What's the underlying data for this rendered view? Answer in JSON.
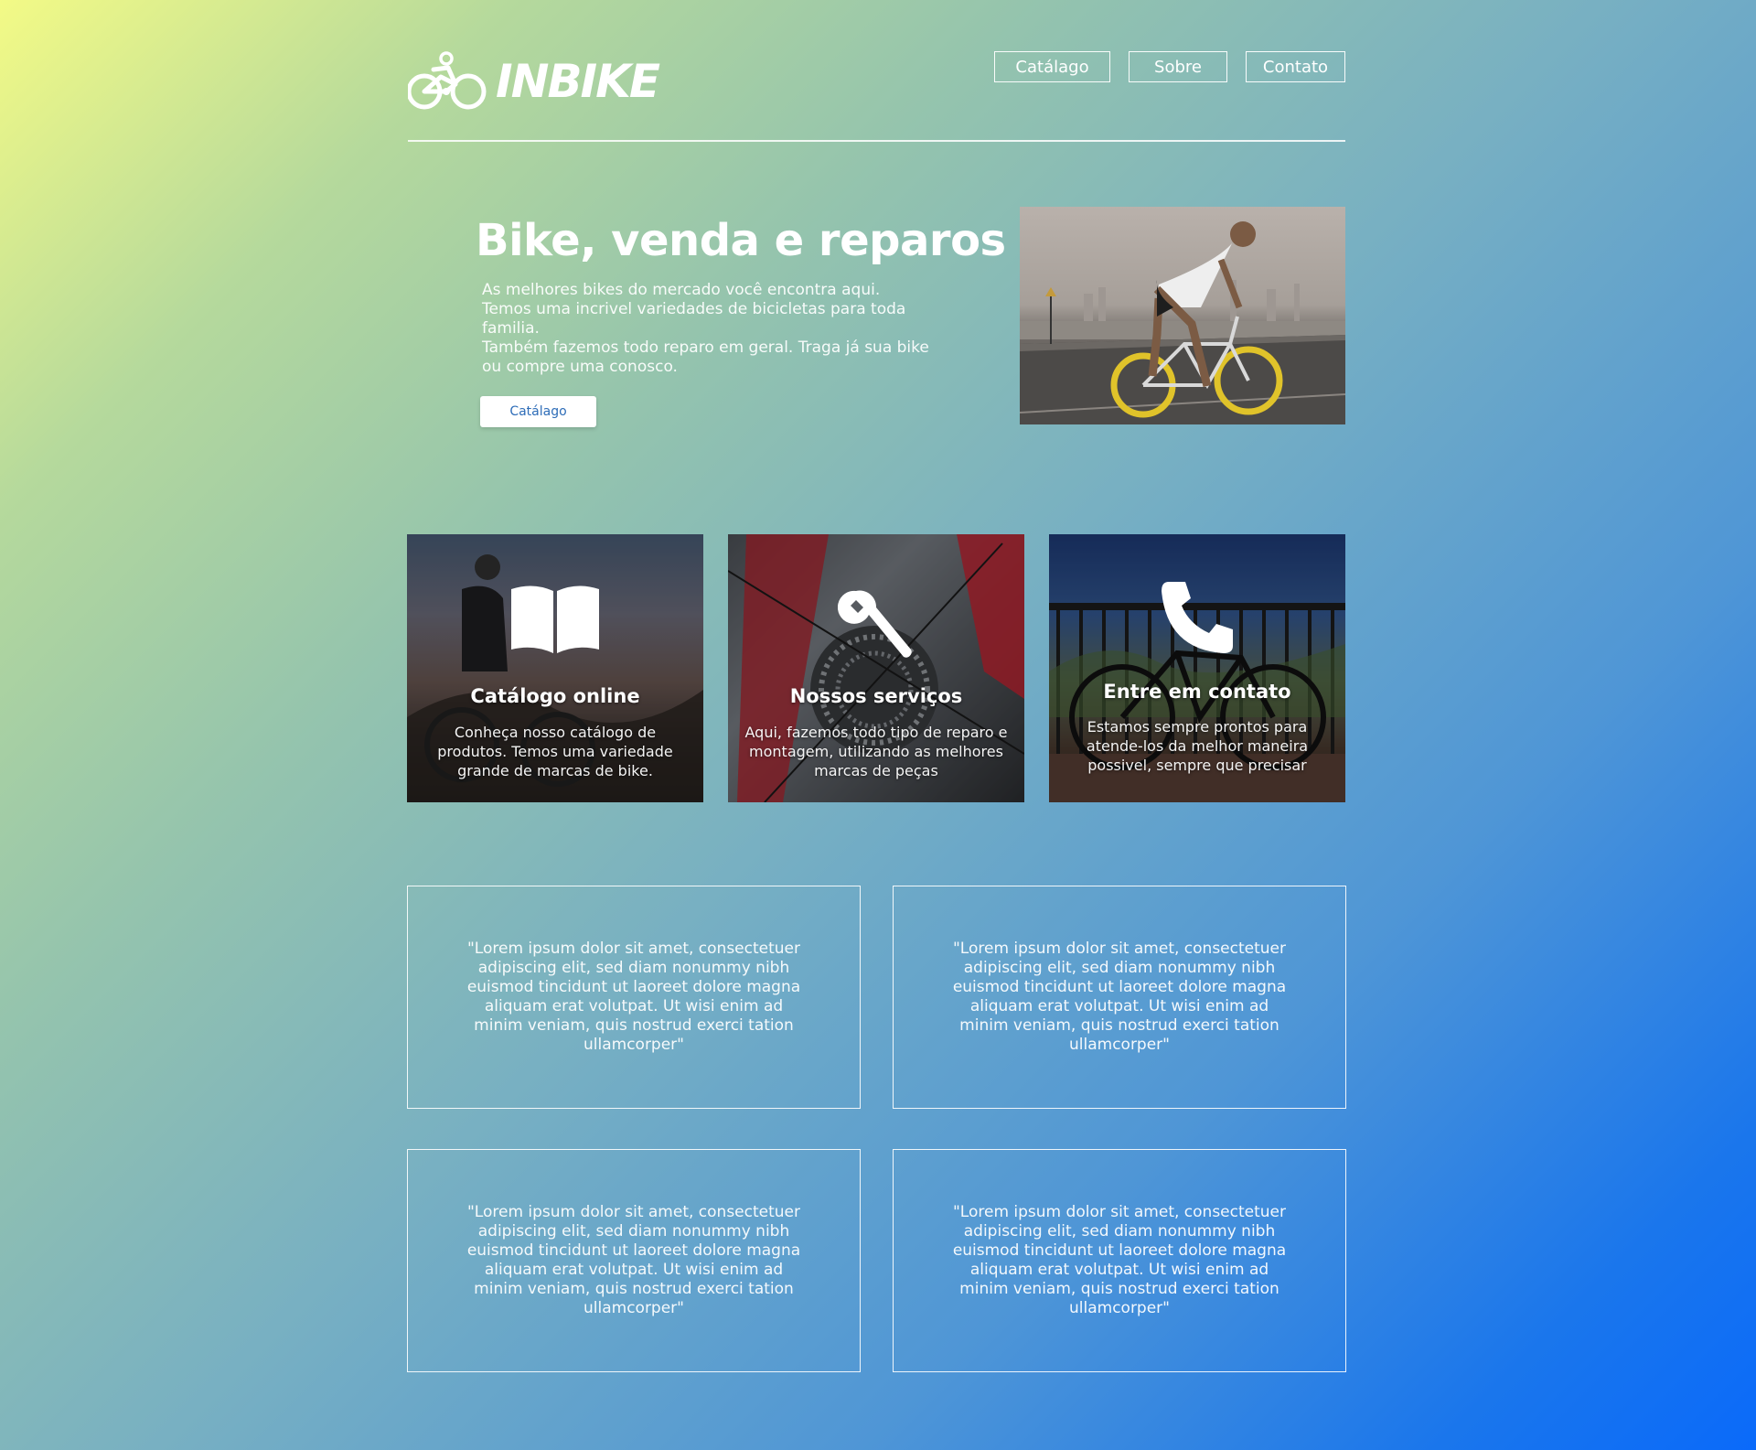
{
  "brand": {
    "name": "INBIKE"
  },
  "nav": {
    "items": [
      "Catálago",
      "Sobre",
      "Contato"
    ]
  },
  "hero": {
    "title": "Bike, venda e reparos",
    "lines": [
      "As melhores bikes do mercado você encontra aqui.",
      "Temos uma incrivel variedades de bicicletas para toda",
      "familia.",
      "Também fazemos todo reparo em geral. Traga já sua bike",
      "ou compre uma conosco."
    ],
    "button_label": "Catálago"
  },
  "cards": [
    {
      "title": "Catálogo online",
      "icon": "book-icon",
      "text": "Conheça nosso catálogo de produtos. Temos uma variedade grande de marcas de bike."
    },
    {
      "title": "Nossos serviços",
      "icon": "wrench-icon",
      "text": "Aqui, fazemos todo tipo de reparo e montagem, utilizando as melhores marcas de peças"
    },
    {
      "title": "Entre em contato",
      "icon": "phone-icon",
      "text": "Estamos sempre prontos para atende-los da melhor maneira possivel, sempre que precisar"
    }
  ],
  "testimonials": [
    "\"Lorem ipsum dolor sit amet, consectetuer adipiscing elit, sed diam nonummy nibh euismod tincidunt ut laoreet dolore magna aliquam erat volutpat. Ut wisi enim ad minim veniam, quis nostrud exerci tation ullamcorper\"",
    "\"Lorem ipsum dolor sit amet, consectetuer adipiscing elit, sed diam nonummy nibh euismod tincidunt ut laoreet dolore magna aliquam erat volutpat. Ut wisi enim ad minim veniam, quis nostrud exerci tation ullamcorper\"",
    "\"Lorem ipsum dolor sit amet, consectetuer adipiscing elit, sed diam nonummy nibh euismod tincidunt ut laoreet dolore magna aliquam erat volutpat. Ut wisi enim ad minim veniam, quis nostrud exerci tation ullamcorper\"",
    "\"Lorem ipsum dolor sit amet, consectetuer adipiscing elit, sed diam nonummy nibh euismod tincidunt ut laoreet dolore magna aliquam erat volutpat. Ut wisi enim ad minim veniam, quis nostrud exerci tation ullamcorper\""
  ],
  "colors": {
    "gradient_start": "#f3fa86",
    "gradient_end": "#0a6afa",
    "button_text": "#2e6db8"
  }
}
